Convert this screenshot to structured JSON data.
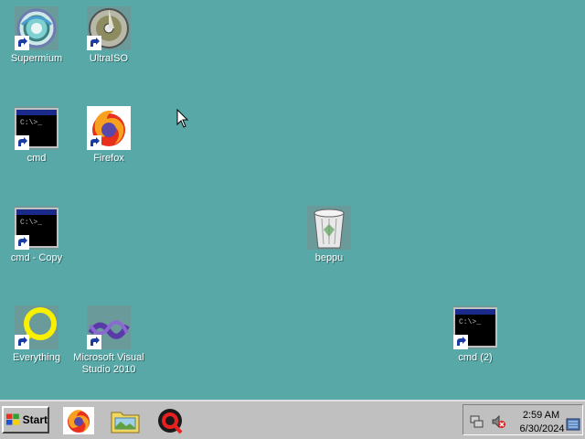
{
  "desktop": {
    "background": "#58a8a8",
    "icons": [
      {
        "label": "Supermium",
        "icon": "supermium-icon"
      },
      {
        "label": "UltraISO",
        "icon": "ultraiso-icon"
      },
      {
        "label": "cmd",
        "icon": "cmd-icon"
      },
      {
        "label": "Firefox",
        "icon": "firefox-icon"
      },
      {
        "label": "cmd - Copy",
        "icon": "cmd-icon"
      },
      {
        "label": "beppu",
        "icon": "recycle-bin-icon"
      },
      {
        "label": "Everything",
        "icon": "everything-icon"
      },
      {
        "label": "Microsoft Visual Studio 2010",
        "icon": "visual-studio-icon"
      },
      {
        "label": "cmd (2)",
        "icon": "cmd-icon"
      }
    ]
  },
  "taskbar": {
    "start_label": "Start",
    "quick_launch": [
      "firefox-icon",
      "folder-icon",
      "quicktime-icon"
    ],
    "tray": {
      "time": "2:59 AM",
      "date": "6/30/2024",
      "icons": [
        "network-icon",
        "volume-muted-icon",
        "keyboard-icon"
      ]
    }
  }
}
